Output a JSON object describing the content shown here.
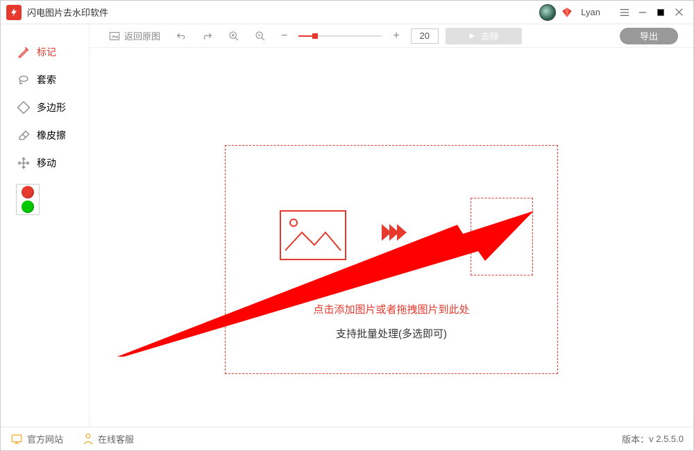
{
  "app": {
    "title": "闪电图片去水印软件"
  },
  "user": {
    "name": "Lyan"
  },
  "sidebar": {
    "tools": [
      {
        "label": "标记"
      },
      {
        "label": "套索"
      },
      {
        "label": "多边形"
      },
      {
        "label": "橡皮擦"
      },
      {
        "label": "移动"
      }
    ]
  },
  "toolbar": {
    "back_label": "返回原图",
    "zoom_value": "20",
    "remove_label": "去除",
    "export_label": "导出"
  },
  "dropzone": {
    "line1": "点击添加图片或者拖拽图片到此处",
    "line2": "支持批量处理(多选即可)"
  },
  "statusbar": {
    "official_site": "官方网站",
    "online_service": "在线客服",
    "version_label": "版本：",
    "version_value": "v 2.5.5.0"
  }
}
